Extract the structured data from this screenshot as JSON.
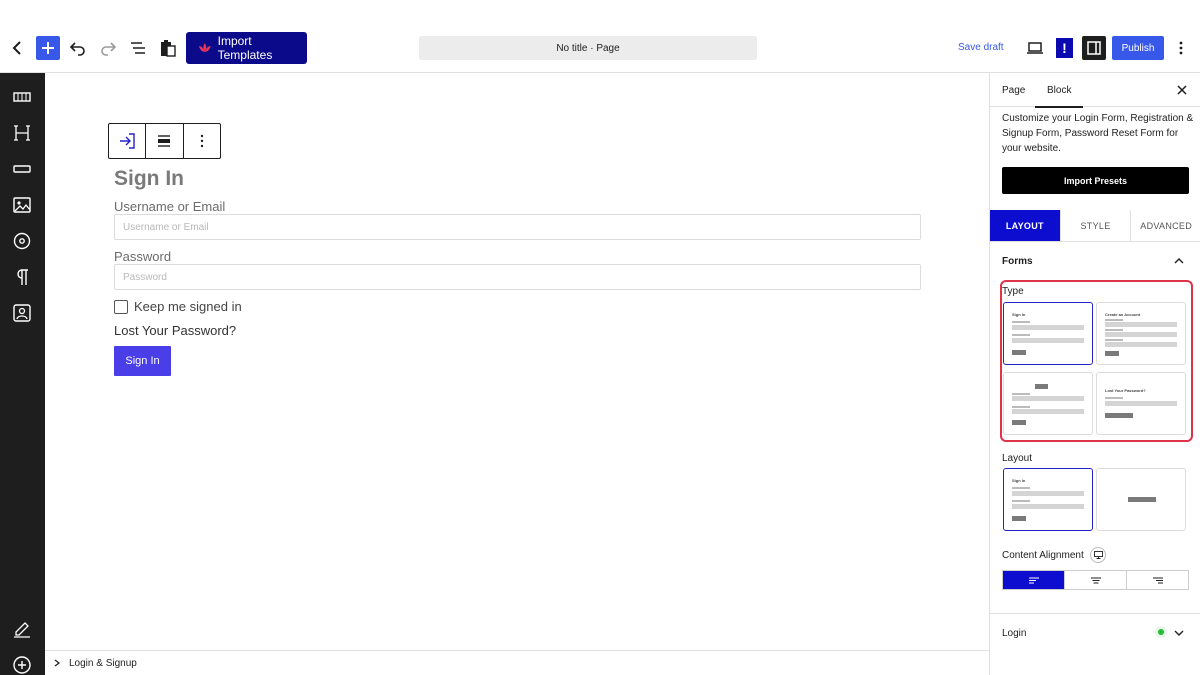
{
  "toolbar": {
    "import_label": "Import Templates",
    "doc_title": "No title · Page",
    "save_draft": "Save draft",
    "bang": "!",
    "publish": "Publish",
    "accent": "#3858e9"
  },
  "block": {
    "title": "Sign In",
    "username_label": "Username or Email",
    "username_placeholder": "Username or Email",
    "password_label": "Password",
    "password_placeholder": "Password",
    "keep_signed": "Keep me signed in",
    "lost_password": "Lost Your Password?",
    "submit": "Sign In",
    "button_color": "#4a3ee8"
  },
  "footer": {
    "breadcrumb": "Login & Signup"
  },
  "sidebar": {
    "tabs": [
      "Page",
      "Block"
    ],
    "description": "Customize your Login Form, Registration & Signup Form, Password Reset Form for your website.",
    "presets_button": "Import Presets",
    "sub_tabs": [
      "LAYOUT",
      "STYLE",
      "ADVANCED"
    ],
    "forms_section": "Forms",
    "type_label": "Type",
    "layout_label": "Layout",
    "content_alignment": "Content Alignment",
    "login_section": "Login",
    "thumbs": {
      "signin_title": "Sign In",
      "create_title": "Create an Account",
      "lost_title": "Lost Your Password?"
    }
  }
}
